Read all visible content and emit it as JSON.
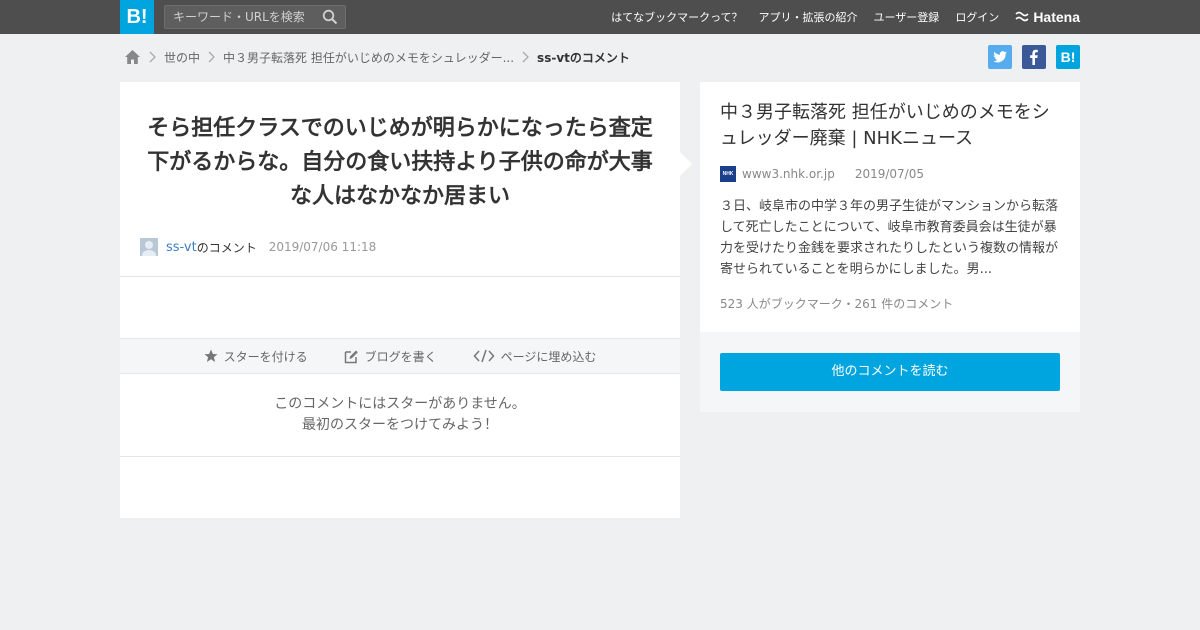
{
  "header": {
    "logo": "B!",
    "search_placeholder": "キーワード・URLを検索",
    "nav": [
      {
        "label": "はてなブックマークって？"
      },
      {
        "label": "アプリ・拡張の紹介"
      },
      {
        "label": "ユーザー登録"
      },
      {
        "label": "ログイン"
      }
    ],
    "hatena_label": "Hatena"
  },
  "breadcrumb": {
    "category": "世の中",
    "entry": "中３男子転落死 担任がいじめのメモをシュレッダー...",
    "current": "ss-vtのコメント"
  },
  "share": {
    "twitter": "t",
    "facebook": "f",
    "hatebu": "B!"
  },
  "comment": {
    "text": "そら担任クラスでのいじめが明らかになったら査定下がるからな。自分の食い扶持より子供の命が大事な人はなかなか居まい",
    "user": "ss-vt",
    "user_suffix": "のコメント",
    "date": "2019/07/06 11:18"
  },
  "actions": {
    "star": "スターを付ける",
    "blog": "ブログを書く",
    "embed": "ページに埋め込む"
  },
  "stars": {
    "line1": "このコメントにはスターがありません。",
    "line2": "最初のスターをつけてみよう！"
  },
  "entry": {
    "title": "中３男子転落死 担任がいじめのメモをシュレッダー廃棄 | NHKニュース",
    "source_icon_text": "NHK",
    "domain": "www3.nhk.or.jp",
    "date": "2019/07/05",
    "description": "３日、岐阜市の中学３年の男子生徒がマンションから転落して死亡したことについて、岐阜市教育委員会は生徒が暴力を受けたり金銭を要求されたりしたという複数の情報が寄せられていることを明らかにしました。男...",
    "counts": "523 人がブックマーク・261 件のコメント",
    "read_more": "他のコメントを読む"
  },
  "colors": {
    "header_bg": "#4e4e4e",
    "brand": "#00a4de",
    "twitter": "#55acee",
    "facebook": "#3b5998",
    "link": "#3b7fc4"
  }
}
